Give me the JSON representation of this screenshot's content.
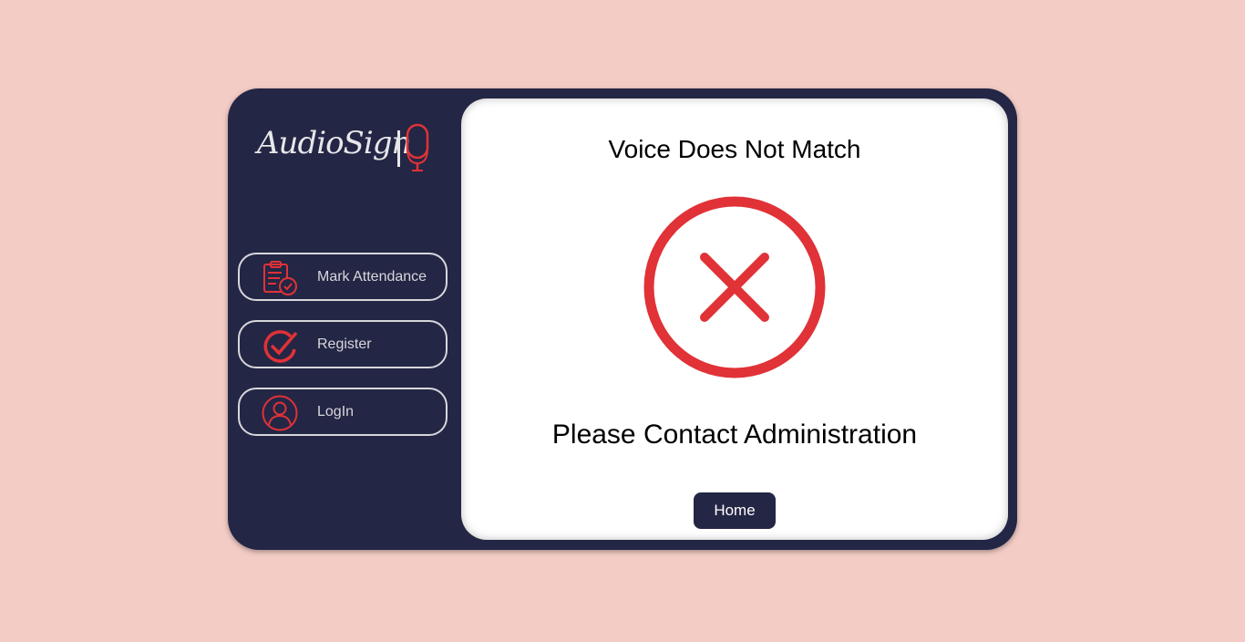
{
  "brand": {
    "name": "AudioSign",
    "icon": "microphone-icon"
  },
  "nav": {
    "items": [
      {
        "label": "Mark Attendance",
        "icon": "clipboard-check-icon"
      },
      {
        "label": "Register",
        "icon": "check-circle-icon"
      },
      {
        "label": "LogIn",
        "icon": "user-icon"
      }
    ]
  },
  "result": {
    "title": "Voice Does Not Match",
    "icon": "error-x-icon",
    "message": "Please Contact Administration",
    "home_label": "Home"
  },
  "colors": {
    "background": "#f4ccc6",
    "sidebar": "#242645",
    "accent": "#e03237",
    "panel": "#ffffff"
  }
}
